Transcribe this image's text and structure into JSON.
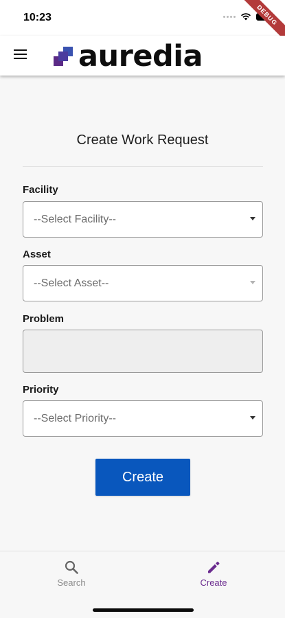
{
  "status_bar": {
    "time": "10:23",
    "debug_label": "DEBUG"
  },
  "app_bar": {
    "logo_text": "auredia",
    "brand_colors": {
      "purple": "#5b2a86",
      "blue": "#3a52b0"
    }
  },
  "form": {
    "title": "Create Work Request",
    "facility": {
      "label": "Facility",
      "value": "--Select Facility--"
    },
    "asset": {
      "label": "Asset",
      "value": "--Select Asset--"
    },
    "problem": {
      "label": "Problem",
      "value": ""
    },
    "priority": {
      "label": "Priority",
      "value": "--Select Priority--"
    },
    "submit_label": "Create",
    "submit_color": "#0957bd"
  },
  "bottom_nav": {
    "items": [
      {
        "label": "Search",
        "icon": "search-icon",
        "active": false
      },
      {
        "label": "Create",
        "icon": "pencil-icon",
        "active": true
      }
    ],
    "active_color": "#6a2b8e"
  }
}
